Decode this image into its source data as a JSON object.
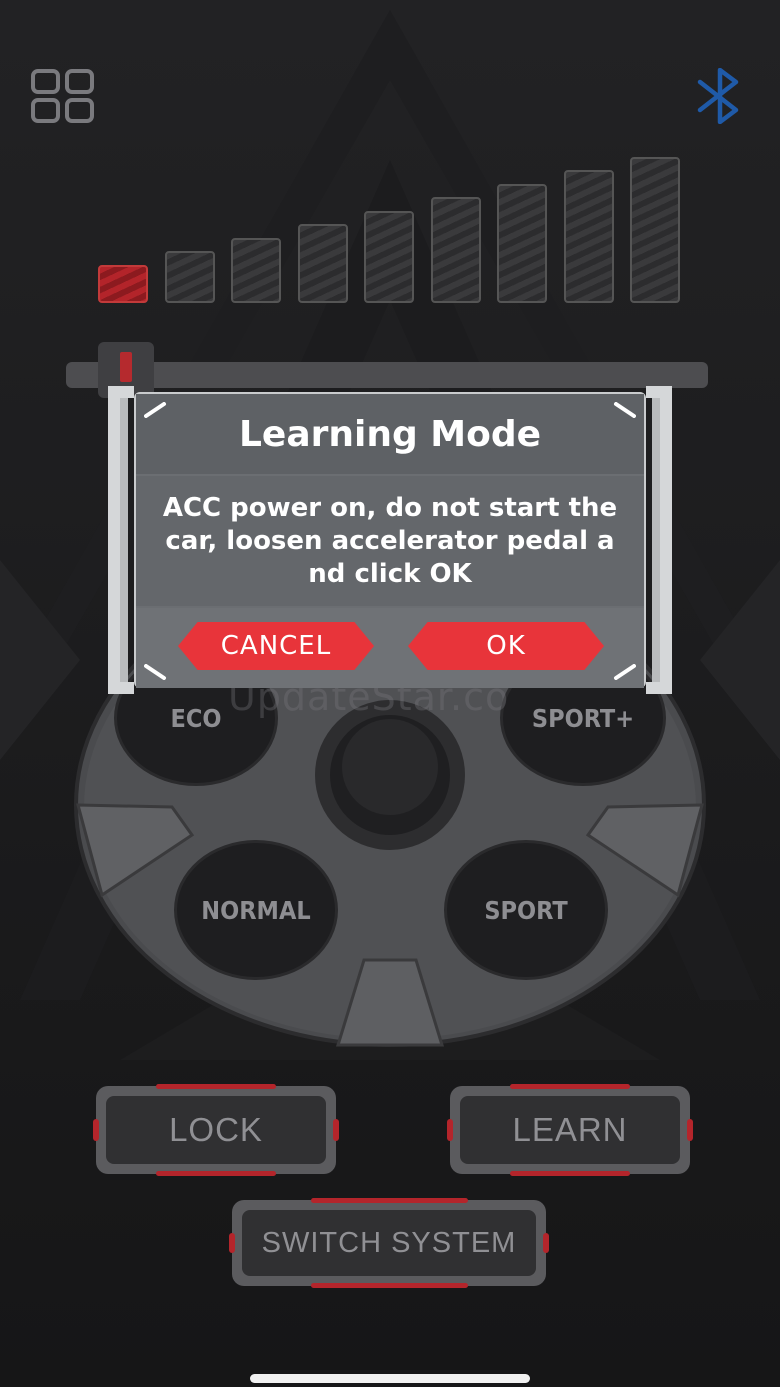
{
  "levels": {
    "count": 9,
    "active": 1
  },
  "wheel": {
    "modes": [
      {
        "key": "eco",
        "label": "ECO"
      },
      {
        "key": "sport-plus",
        "label": "SPORT+"
      },
      {
        "key": "normal",
        "label": "NORMAL"
      },
      {
        "key": "sport",
        "label": "SPORT"
      }
    ]
  },
  "watermark": "UpdateStar.co",
  "buttons": {
    "lock": "LOCK",
    "learn": "LEARN",
    "switch_system": "SWITCH SYSTEM"
  },
  "dialog": {
    "title": "Learning Mode",
    "message_line1": "ACC power on, do not start the",
    "message_line2": "car, loosen accelerator pedal a",
    "message_line3": "nd click OK",
    "cancel": "CANCEL",
    "ok": "OK"
  },
  "colors": {
    "accent_red": "#e8343a",
    "bluetooth_blue": "#1f5aa8",
    "background": "#1a1a1b"
  },
  "icons": {
    "menu": "grid-menu-icon",
    "bluetooth": "bluetooth-icon"
  }
}
